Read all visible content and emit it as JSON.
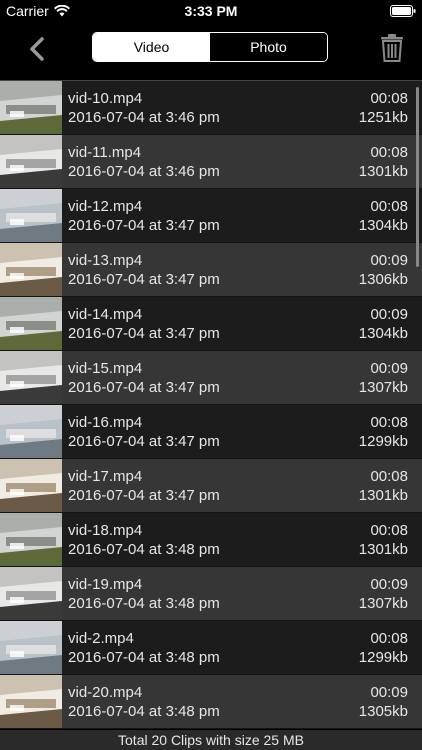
{
  "status": {
    "carrier": "Carrier",
    "time": "3:33 PM"
  },
  "nav": {
    "segments": [
      {
        "label": "Video",
        "active": true
      },
      {
        "label": "Photo",
        "active": false
      }
    ]
  },
  "clips": [
    {
      "name": "vid-10.mp4",
      "date": "2016-07-04 at 3:46 pm",
      "duration": "00:08",
      "size": "1251kb"
    },
    {
      "name": "vid-11.mp4",
      "date": "2016-07-04 at 3:46 pm",
      "duration": "00:08",
      "size": "1301kb"
    },
    {
      "name": "vid-12.mp4",
      "date": "2016-07-04 at 3:47 pm",
      "duration": "00:08",
      "size": "1304kb"
    },
    {
      "name": "vid-13.mp4",
      "date": "2016-07-04 at 3:47 pm",
      "duration": "00:09",
      "size": "1306kb"
    },
    {
      "name": "vid-14.mp4",
      "date": "2016-07-04 at 3:47 pm",
      "duration": "00:09",
      "size": "1304kb"
    },
    {
      "name": "vid-15.mp4",
      "date": "2016-07-04 at 3:47 pm",
      "duration": "00:09",
      "size": "1307kb"
    },
    {
      "name": "vid-16.mp4",
      "date": "2016-07-04 at 3:47 pm",
      "duration": "00:08",
      "size": "1299kb"
    },
    {
      "name": "vid-17.mp4",
      "date": "2016-07-04 at 3:47 pm",
      "duration": "00:08",
      "size": "1301kb"
    },
    {
      "name": "vid-18.mp4",
      "date": "2016-07-04 at 3:48 pm",
      "duration": "00:08",
      "size": "1301kb"
    },
    {
      "name": "vid-19.mp4",
      "date": "2016-07-04 at 3:48 pm",
      "duration": "00:09",
      "size": "1307kb"
    },
    {
      "name": "vid-2.mp4",
      "date": "2016-07-04 at 3:48 pm",
      "duration": "00:08",
      "size": "1299kb"
    },
    {
      "name": "vid-20.mp4",
      "date": "2016-07-04 at 3:48 pm",
      "duration": "00:09",
      "size": "1305kb"
    }
  ],
  "footer": {
    "summary": "Total 20 Clips with size 25 MB"
  },
  "colors": {
    "row_dark": "#1c1c1c",
    "row_light": "#363636",
    "text": "#e6e6e6",
    "accent": "#ffffff"
  },
  "icons": {
    "back": "chevron-left-icon",
    "trash": "trash-icon",
    "wifi": "wifi-icon",
    "battery": "battery-icon"
  }
}
